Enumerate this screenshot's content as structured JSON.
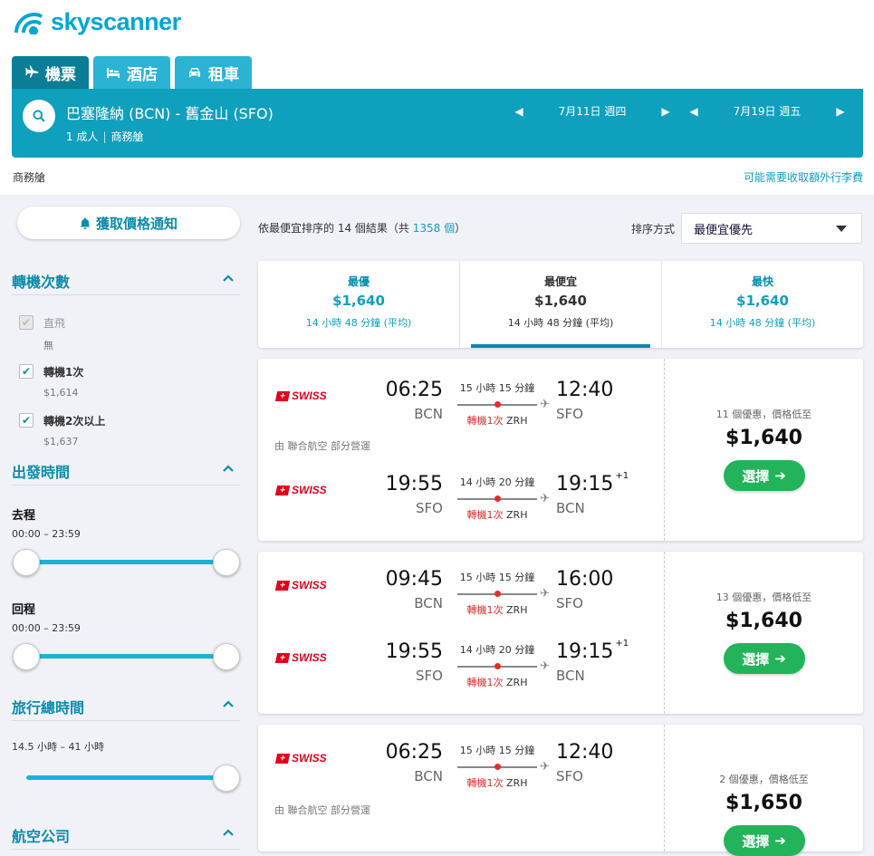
{
  "brand": {
    "name": "skyscanner"
  },
  "tabs": [
    {
      "label": "機票",
      "icon": "plane-icon",
      "active": true
    },
    {
      "label": "酒店",
      "icon": "bed-icon",
      "active": false
    },
    {
      "label": "租車",
      "icon": "car-icon",
      "active": false
    }
  ],
  "search": {
    "route": "巴塞隆納 (BCN) - 舊金山 (SFO)",
    "passengers": "1 成人",
    "cabin": "商務艙",
    "outbound_date": "7月11日 週四",
    "return_date": "7月19日 週五"
  },
  "cabin_label": "商務艙",
  "baggage_note": "可能需要收取額外行李費",
  "sidebar": {
    "price_alert": "獲取價格通知",
    "stops": {
      "title": "轉機次數",
      "options": [
        {
          "label": "直飛",
          "price": "無",
          "checked": true,
          "disabled": true
        },
        {
          "label": "轉機1次",
          "price": "$1,614",
          "checked": true,
          "disabled": false
        },
        {
          "label": "轉機2次以上",
          "price": "$1,637",
          "checked": true,
          "disabled": false
        }
      ]
    },
    "departure_times": {
      "title": "出發時間",
      "outbound_label": "去程",
      "outbound_range": "00:00 – 23:59",
      "return_label": "回程",
      "return_range": "00:00 – 23:59"
    },
    "journey_duration": {
      "title": "旅行總時間",
      "range": "14.5 小時 – 41 小時"
    },
    "airlines": {
      "title": "航空公司"
    }
  },
  "results": {
    "prefix": "依最便宜排序的 14 個結果（共 ",
    "total_link": "1358 個",
    "suffix": "）",
    "sort_label": "排序方式",
    "sort_value": "最便宜優先"
  },
  "summary": [
    {
      "label": "最優",
      "price": "$1,640",
      "duration": "14 小時 48 分鐘 (平均)",
      "active": false
    },
    {
      "label": "最便宜",
      "price": "$1,640",
      "duration": "14 小時 48 分鐘 (平均)",
      "active": true
    },
    {
      "label": "最快",
      "price": "$1,640",
      "duration": "14 小時 48 分鐘 (平均)",
      "active": false
    }
  ],
  "cards": [
    {
      "legs": [
        {
          "airline": "SWISS",
          "dep_time": "06:25",
          "dep_code": "BCN",
          "duration": "15 小時 15 分鐘",
          "stops": "轉機1次",
          "via": "ZRH",
          "arr_time": "12:40",
          "arr_code": "SFO",
          "plus": ""
        },
        {
          "airline": "SWISS",
          "dep_time": "19:55",
          "dep_code": "SFO",
          "duration": "14 小時 20 分鐘",
          "stops": "轉機1次",
          "via": "ZRH",
          "arr_time": "19:15",
          "arr_code": "BCN",
          "plus": "+1"
        }
      ],
      "operated": "由 聯合航空 部分營運",
      "deals": "11 個優惠，價格低至",
      "price": "$1,640",
      "select": "選擇"
    },
    {
      "legs": [
        {
          "airline": "SWISS",
          "dep_time": "09:45",
          "dep_code": "BCN",
          "duration": "15 小時 15 分鐘",
          "stops": "轉機1次",
          "via": "ZRH",
          "arr_time": "16:00",
          "arr_code": "SFO",
          "plus": ""
        },
        {
          "airline": "SWISS",
          "dep_time": "19:55",
          "dep_code": "SFO",
          "duration": "14 小時 20 分鐘",
          "stops": "轉機1次",
          "via": "ZRH",
          "arr_time": "19:15",
          "arr_code": "BCN",
          "plus": "+1"
        }
      ],
      "operated": "",
      "deals": "13 個優惠，價格低至",
      "price": "$1,640",
      "select": "選擇"
    },
    {
      "legs": [
        {
          "airline": "SWISS",
          "dep_time": "06:25",
          "dep_code": "BCN",
          "duration": "15 小時 15 分鐘",
          "stops": "轉機1次",
          "via": "ZRH",
          "arr_time": "12:40",
          "arr_code": "SFO",
          "plus": ""
        }
      ],
      "operated": "由 聯合航空 部分營運",
      "deals": "2 個優惠，價格低至",
      "price": "$1,650",
      "select": "選擇"
    }
  ],
  "colors": {
    "brand": "#00a6d4",
    "teal": "#0fa0bd",
    "green": "#22b35b",
    "swiss_red": "#e2001a"
  }
}
